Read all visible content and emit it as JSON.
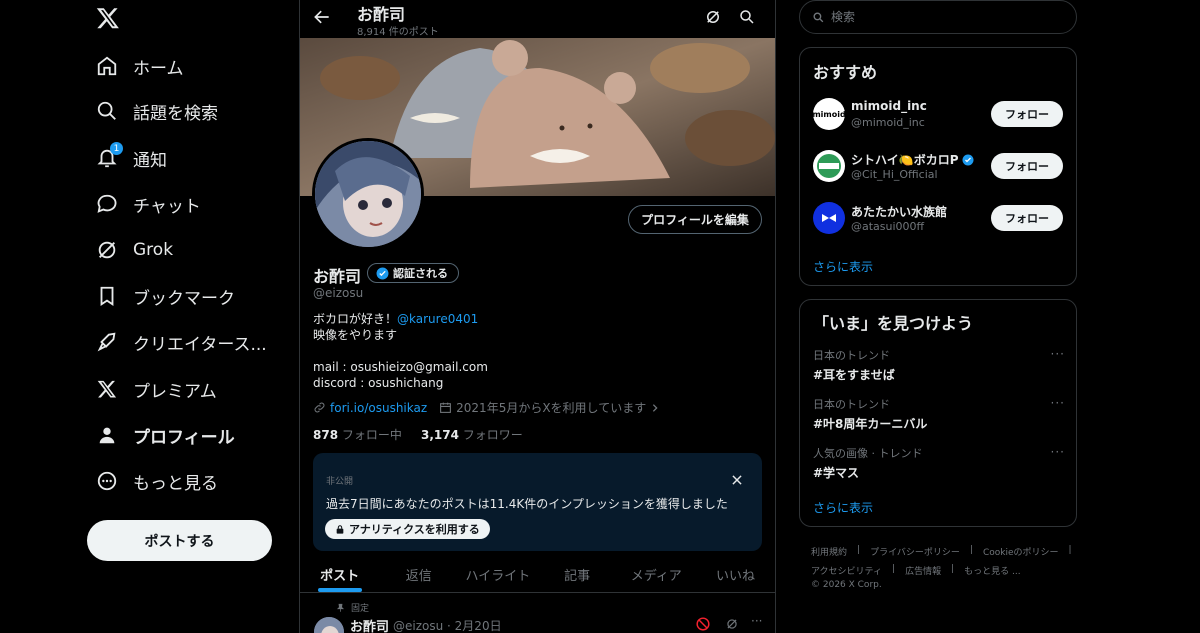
{
  "nav": {
    "items": [
      {
        "label": "ホーム"
      },
      {
        "label": "話題を検索"
      },
      {
        "label": "通知",
        "badge": "1"
      },
      {
        "label": "チャット"
      },
      {
        "label": "Grok"
      },
      {
        "label": "ブックマーク"
      },
      {
        "label": "クリエイタース..."
      },
      {
        "label": "プレミアム"
      },
      {
        "label": "プロフィール"
      },
      {
        "label": "もっと見る"
      }
    ],
    "post_button": "ポストする"
  },
  "header": {
    "title": "お酢司",
    "post_count": "8,914 件のポスト"
  },
  "profile": {
    "edit_button": "プロフィールを編集",
    "name": "お酢司",
    "verify_label": "認証される",
    "handle": "@eizosu",
    "bio_line1_text": "ボカロが好き！",
    "bio_line1_mention": "@karure0401",
    "bio_line2": "映像をやります",
    "bio_line3": "mail : osushieizo@gmail.com",
    "bio_line4": "discord : osushichang",
    "link": "fori.io/osushikaz",
    "joined": "2021年5月からXを利用しています",
    "following_count": "878",
    "following_label": "フォロー中",
    "followers_count": "3,174",
    "followers_label": "フォロワー"
  },
  "insight": {
    "label": "非公開",
    "text": "過去7日間にあなたのポストは11.4K件のインプレッションを獲得しました",
    "button": "アナリティクスを利用する"
  },
  "tabs": [
    "ポスト",
    "返信",
    "ハイライト",
    "記事",
    "メディア",
    "いいね"
  ],
  "pinned_post": {
    "pinned_label": "固定",
    "name": "お酢司",
    "handle_date": "@eizosu · 2月20日"
  },
  "search": {
    "placeholder": "検索"
  },
  "recommend": {
    "title": "おすすめ",
    "users": [
      {
        "name": "mimoid_inc",
        "handle": "@mimoid_inc",
        "follow": "フォロー",
        "avatar_text": "mimoid"
      },
      {
        "name": "シトハイ🍋ボカロP",
        "handle": "@Cit_Hi_Official",
        "follow": "フォロー",
        "verified": true
      },
      {
        "name": "あたたかい水族館",
        "handle": "@atasui000ff",
        "follow": "フォロー"
      }
    ],
    "more": "さらに表示"
  },
  "trends": {
    "title": "「いま」を見つけよう",
    "items": [
      {
        "category": "日本のトレンド",
        "topic": "#耳をすませば"
      },
      {
        "category": "日本のトレンド",
        "topic": "#叶8周年カーニバル"
      },
      {
        "category": "人気の画像 · トレンド",
        "topic": "#学マス"
      }
    ],
    "more": "さらに表示"
  },
  "footer": {
    "links": [
      "利用規約",
      "プライバシーポリシー",
      "Cookieのポリシー",
      "アクセシビリティ",
      "広告情報",
      "もっと見る ..."
    ],
    "copyright": "© 2026 X Corp."
  },
  "colors": {
    "accent": "#1d9bf0",
    "background": "#000000",
    "border": "#2f3336"
  }
}
